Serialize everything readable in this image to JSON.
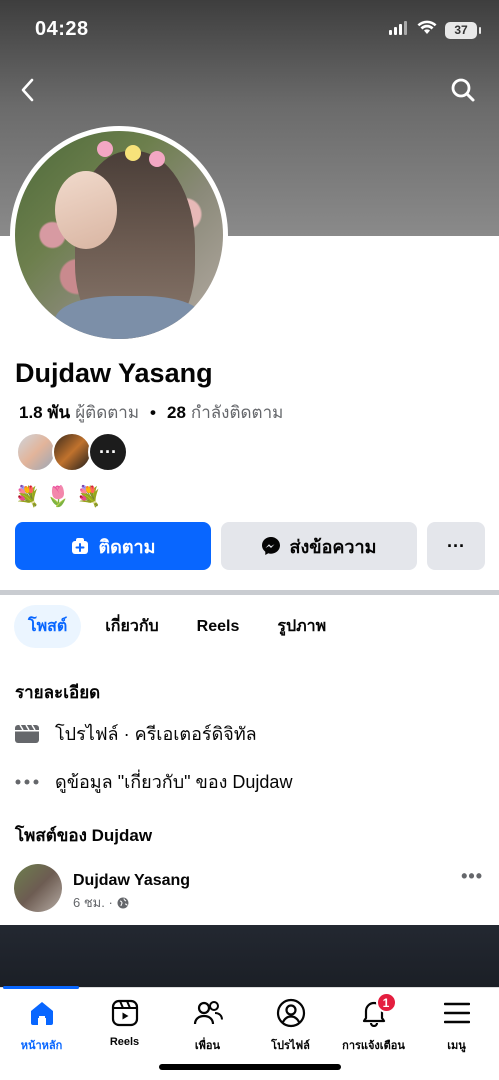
{
  "status_bar": {
    "time": "04:28",
    "battery": "37"
  },
  "profile": {
    "name": "Dujdaw Yasang",
    "followers_count": "1.8 พัน",
    "followers_label": "ผู้ติดตาม",
    "following_count": "28",
    "following_label": "กำลังติดตาม",
    "bio_emojis": "💐🌷💐"
  },
  "actions": {
    "follow_label": "ติดตาม",
    "message_label": "ส่งข้อความ",
    "more_label": "···"
  },
  "tabs": [
    {
      "label": "โพสต์",
      "active": true
    },
    {
      "label": "เกี่ยวกับ",
      "active": false
    },
    {
      "label": "Reels",
      "active": false
    },
    {
      "label": "รูปภาพ",
      "active": false
    }
  ],
  "details": {
    "title": "รายละเอียด",
    "profile_type": "โปรไฟล์ · ครีเอเตอร์ดิจิทัล",
    "about_link": "ดูข้อมูล \"เกี่ยวกับ\" ของ Dujdaw"
  },
  "posts_section": {
    "title": "โพสต์ของ Dujdaw"
  },
  "post": {
    "author": "Dujdaw Yasang",
    "time": "6 ชม. ·"
  },
  "bottom_nav": {
    "items": [
      {
        "label": "หน้าหลัก",
        "icon": "home-icon"
      },
      {
        "label": "Reels",
        "icon": "reels-icon"
      },
      {
        "label": "เพื่อน",
        "icon": "friends-icon"
      },
      {
        "label": "โปรไฟล์",
        "icon": "profile-icon"
      },
      {
        "label": "การแจ้งเตือน",
        "icon": "bell-icon"
      },
      {
        "label": "เมนู",
        "icon": "menu-icon"
      }
    ],
    "notification_badge": "1"
  },
  "colors": {
    "accent": "#0866ff",
    "badge": "#e41e3f",
    "secondary_button": "#e4e6eb"
  }
}
